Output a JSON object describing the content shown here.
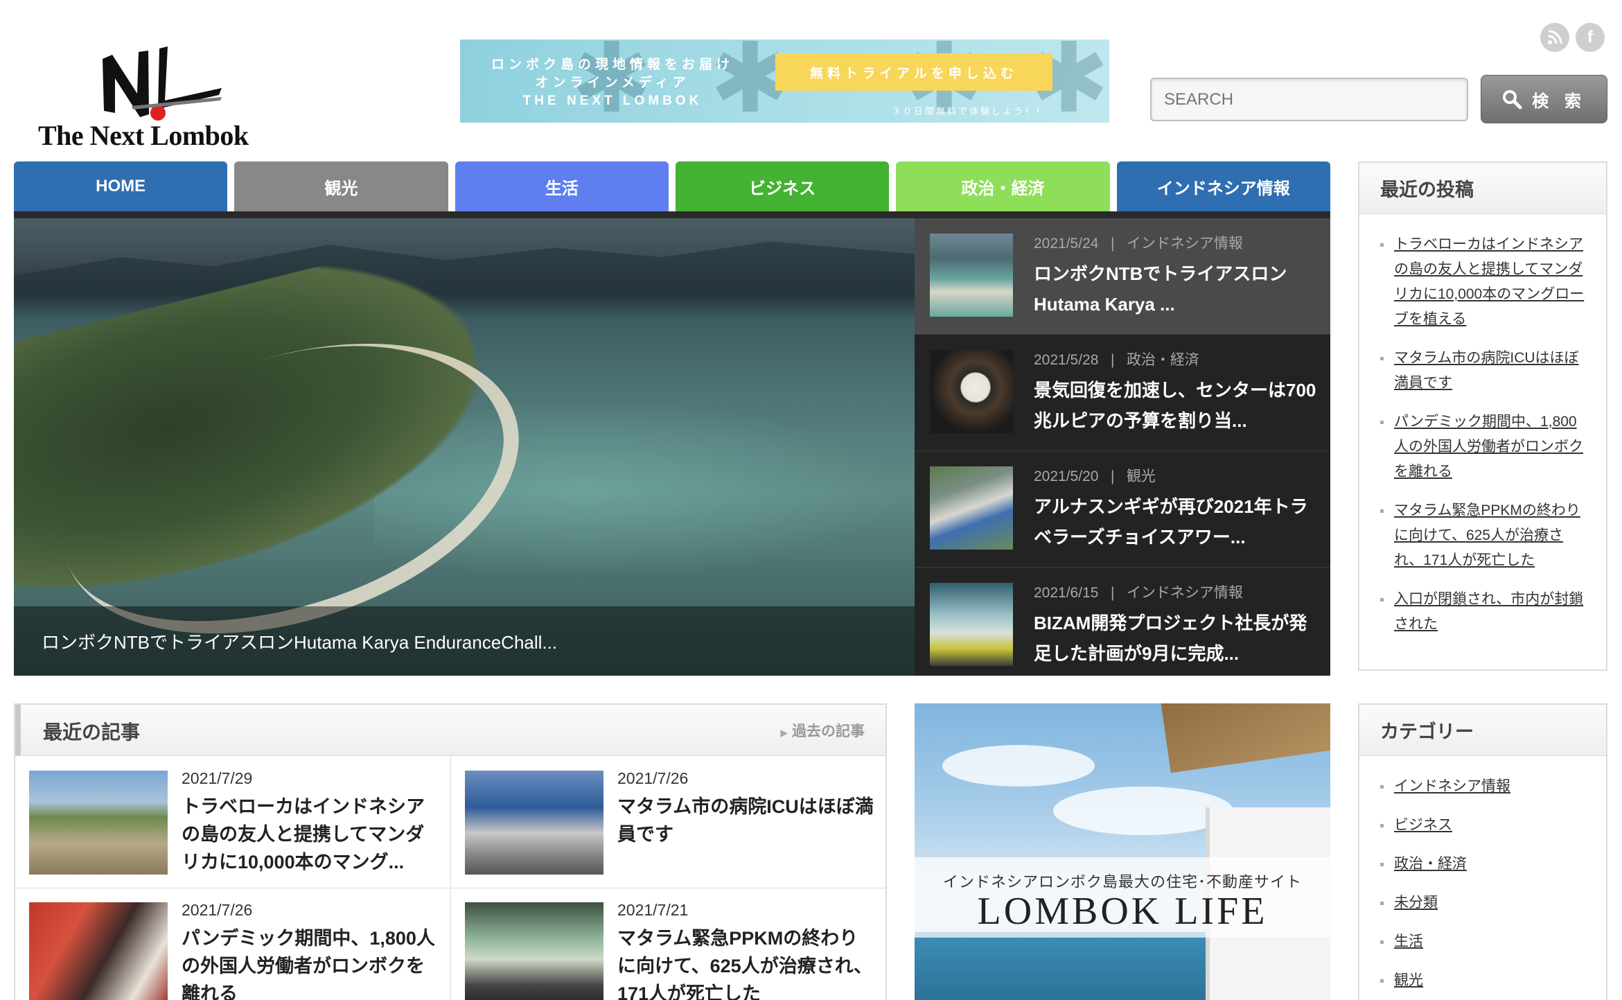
{
  "header": {
    "logo_text": "The Next Lombok",
    "search_placeholder": "SEARCH",
    "search_button": "検 索",
    "social": [
      "rss-icon",
      "facebook-icon"
    ]
  },
  "banner": {
    "line1": "ロンボク島の現地情報をお届け",
    "line2": "オンラインメディア",
    "line3": "THE NEXT LOMBOK",
    "cta": "無料トライアルを申し込む",
    "note": "３０日間無料で体験しよう！！"
  },
  "nav": [
    {
      "label": "HOME",
      "color": "#2f6eb1"
    },
    {
      "label": "観光",
      "color": "#888888"
    },
    {
      "label": "生活",
      "color": "#5f7ef0"
    },
    {
      "label": "ビジネス",
      "color": "#44b233"
    },
    {
      "label": "政治・経済",
      "color": "#8ede5a"
    },
    {
      "label": "インドネシア情報",
      "color": "#2f6eb1"
    }
  ],
  "hero": {
    "caption": "ロンボクNTBでトライアスロンHutama Karya EnduranceChall..."
  },
  "hero_list": [
    {
      "date": "2021/5/24",
      "sep": "|",
      "category": "インドネシア情報",
      "title": "ロンボクNTBでトライアスロンHutama Karya ..."
    },
    {
      "date": "2021/5/28",
      "sep": "|",
      "category": "政治・経済",
      "title": "景気回復を加速し、センターは700兆ルピアの予算を割り当..."
    },
    {
      "date": "2021/5/20",
      "sep": "|",
      "category": "観光",
      "title": "アルナスンギギが再び2021年トラベラーズチョイスアワー..."
    },
    {
      "date": "2021/6/15",
      "sep": "|",
      "category": "インドネシア情報",
      "title": "BIZAM開発プロジェクト社長が発足した計画が9月に完成..."
    }
  ],
  "recent": {
    "heading": "最近の記事",
    "more": "過去の記事",
    "items": [
      {
        "date": "2021/7/29",
        "title": "トラベローカはインドネシアの島の友人と提携してマンダリカに10,000本のマング..."
      },
      {
        "date": "2021/7/26",
        "title": "マタラム市の病院ICUはほぼ満員です"
      },
      {
        "date": "2021/7/26",
        "title": "パンデミック期間中、1,800人の外国人労働者がロンボクを離れる"
      },
      {
        "date": "2021/7/21",
        "title": "マタラム緊急PPKMの終わりに向けて、625人が治療され、171人が死亡した"
      }
    ]
  },
  "lombok_life": {
    "tagline": "インドネシアロンボク島最大の住宅･不動産サイト",
    "brand": "LOMBOK  LIFE"
  },
  "sidebar": {
    "recent_posts_title": "最近の投稿",
    "recent_posts": [
      "トラベローカはインドネシアの島の友人と提携してマンダリカに10,000本のマングローブを植える",
      "マタラム市の病院ICUはほぼ満員です",
      "パンデミック期間中、1,800人の外国人労働者がロンボクを離れる",
      "マタラム緊急PPKMの終わりに向けて、625人が治療され、171人が死亡した",
      "入口が閉鎖され、市内が封鎖された"
    ],
    "categories_title": "カテゴリー",
    "categories": [
      "インドネシア情報",
      "ビジネス",
      "政治・経済",
      "未分類",
      "生活",
      "観光"
    ]
  }
}
